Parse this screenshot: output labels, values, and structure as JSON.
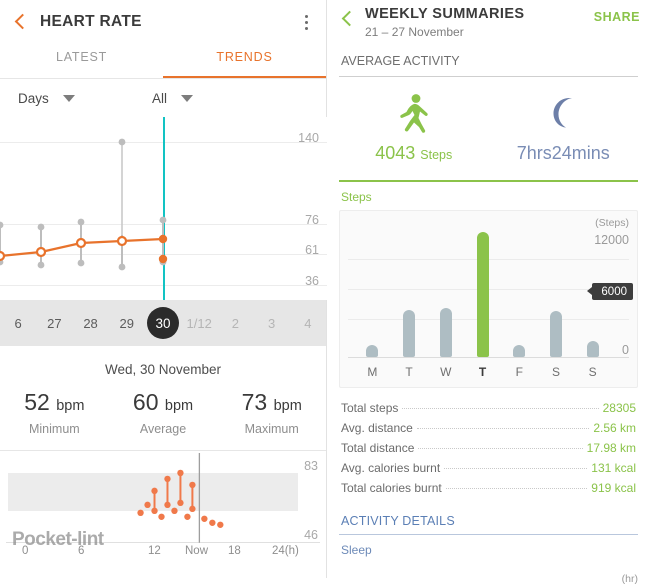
{
  "left": {
    "header": {
      "title": "HEART RATE",
      "back_icon": "back-chevron-icon",
      "menu_icon": "kebab-menu-icon"
    },
    "tabs": [
      {
        "label": "LATEST",
        "active": false
      },
      {
        "label": "TRENDS",
        "active": true
      }
    ],
    "selectors": [
      {
        "label": "Days",
        "icon": "chevron-down-icon"
      },
      {
        "label": "All",
        "icon": "chevron-down-icon"
      }
    ],
    "trend_chart": {
      "y_labels": [
        "140",
        "76",
        "61",
        "36"
      ],
      "cursor_color": "#12c3c3",
      "line_color": "#e8732c"
    },
    "date_strip": [
      {
        "label": "6",
        "state": "partial"
      },
      {
        "label": "27",
        "state": "normal"
      },
      {
        "label": "28",
        "state": "normal"
      },
      {
        "label": "29",
        "state": "normal"
      },
      {
        "label": "30",
        "state": "selected"
      },
      {
        "label": "1/12",
        "state": "dim"
      },
      {
        "label": "2",
        "state": "dim"
      },
      {
        "label": "3",
        "state": "dim"
      },
      {
        "label": "4",
        "state": "dim"
      }
    ],
    "day_label": "Wed, 30 November",
    "bpm": [
      {
        "value": "52",
        "unit": "bpm",
        "sub": "Minimum"
      },
      {
        "value": "60",
        "unit": "bpm",
        "sub": "Average"
      },
      {
        "value": "73",
        "unit": "bpm",
        "sub": "Maximum"
      }
    ],
    "low_chart": {
      "y_top": "83",
      "y_bottom": "46",
      "x_labels": [
        "0",
        "6",
        "12",
        "Now",
        "18",
        "24(h)"
      ]
    },
    "watermark": "Pocket-lint"
  },
  "right": {
    "header": {
      "title": "WEEKLY SUMMARIES",
      "subtitle": "21 – 27 November",
      "share_label": "SHARE",
      "back_icon": "back-chevron-icon"
    },
    "section_average": "AVERAGE ACTIVITY",
    "average": [
      {
        "icon": "running-person-icon",
        "value": "4043",
        "unit": "Steps",
        "color": "#8bc34a"
      },
      {
        "icon": "moon-icon",
        "value": "7hrs24mins",
        "unit": "",
        "color": "#7a8db5"
      }
    ],
    "steps_label": "Steps",
    "stats": [
      {
        "label": "Total steps",
        "value": "28305"
      },
      {
        "label": "Avg. distance",
        "value": "2.56 km"
      },
      {
        "label": "Total distance",
        "value": "17.98 km"
      },
      {
        "label": "Avg. calories burnt",
        "value": "131 kcal"
      },
      {
        "label": "Total calories burnt",
        "value": "919 kcal"
      }
    ],
    "section_details": "ACTIVITY DETAILS",
    "sleep_label": "Sleep",
    "sleep_unit": "(hr)"
  },
  "chart_data": [
    {
      "type": "line",
      "title": "Heart rate trends",
      "xlabel": "",
      "ylabel": "bpm",
      "ylim": [
        36,
        140
      ],
      "grid": true,
      "categories": [
        "26",
        "27",
        "28",
        "29",
        "30",
        "1/12",
        "2",
        "3",
        "4"
      ],
      "series": [
        {
          "name": "average",
          "values": [
            55,
            59,
            62,
            61,
            63,
            null,
            null,
            null,
            null
          ]
        },
        {
          "name": "maximum",
          "values": [
            76,
            74,
            76,
            140,
            78,
            null,
            null,
            null,
            null
          ]
        },
        {
          "name": "minimum",
          "values": [
            50,
            52,
            51,
            50,
            52,
            null,
            null,
            null,
            null
          ]
        }
      ],
      "ytick_labels": [
        "140",
        "76",
        "61",
        "36"
      ]
    },
    {
      "type": "scatter",
      "title": "Today heart rate",
      "xlabel": "(h)",
      "ylabel": "bpm",
      "ylim": [
        46,
        83
      ],
      "grid": false,
      "x": [
        11.5,
        12.2,
        12.6,
        13.0,
        13.4,
        13.8,
        14.2,
        14.6,
        15.0,
        15.4,
        15.8,
        16.2
      ],
      "y": [
        52,
        68,
        62,
        74,
        60,
        72,
        56,
        64,
        58,
        56,
        54,
        52
      ],
      "xtick_labels": [
        "0",
        "6",
        "12",
        "Now",
        "18",
        "24(h)"
      ],
      "ytick_labels": [
        "83",
        "46"
      ]
    },
    {
      "type": "bar",
      "title": "Weekly steps",
      "xlabel": "",
      "ylabel": "(Steps)",
      "ylim": [
        0,
        12000
      ],
      "grid": true,
      "categories": [
        "M",
        "T",
        "W",
        "T",
        "F",
        "S",
        "S"
      ],
      "values": [
        1100,
        4300,
        4500,
        11400,
        1100,
        4200,
        1500
      ],
      "highlight_index": 3,
      "highlight_color": "#8bc34a",
      "bar_color": "#aebdc3",
      "annotations": [
        {
          "label": "6000",
          "value": 6000
        }
      ],
      "ytick_labels": [
        "12000",
        "0"
      ]
    }
  ]
}
